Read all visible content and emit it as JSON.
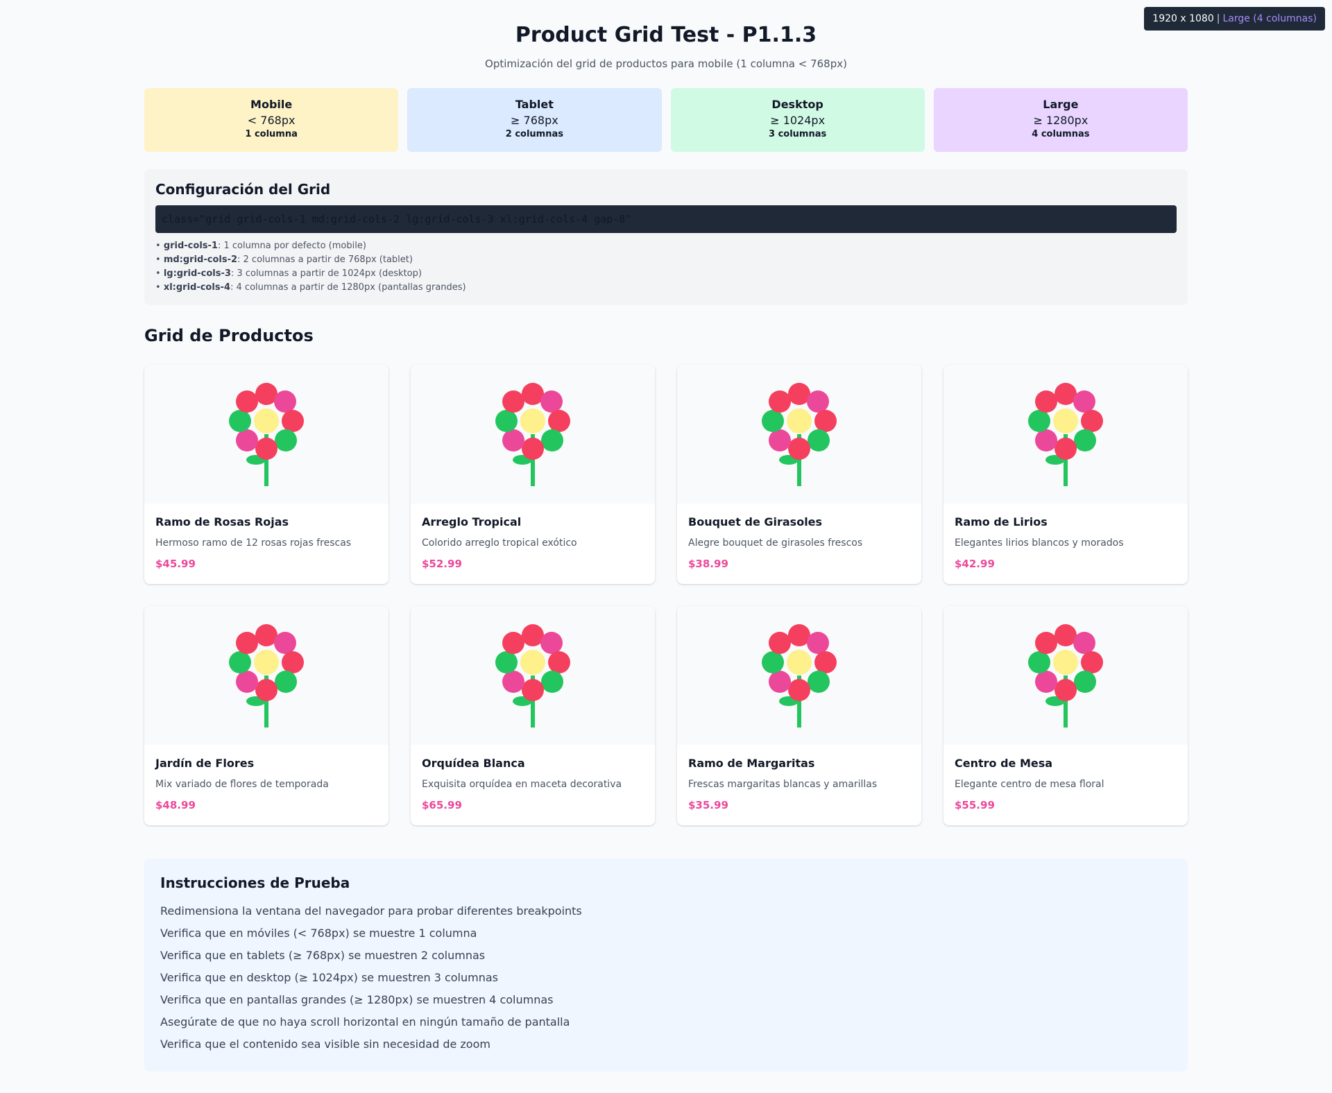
{
  "viewport_badge": {
    "size": "1920 x 1080",
    "label": "Large (4 columnas)"
  },
  "header": {
    "title": "Product Grid Test - P1.1.3",
    "subtitle": "Optimización del grid de productos para mobile (1 columna < 768px)"
  },
  "breakpoints": [
    {
      "title": "Mobile",
      "width": "< 768px",
      "columns": "1 columna",
      "color": "#fef3c7"
    },
    {
      "title": "Tablet",
      "width": "≥ 768px",
      "columns": "2 columnas",
      "color": "#dbeafe"
    },
    {
      "title": "Desktop",
      "width": "≥ 1024px",
      "columns": "3 columnas",
      "color": "#d1fae5"
    },
    {
      "title": "Large",
      "width": "≥ 1280px",
      "columns": "4 columnas",
      "color": "#e9d5ff"
    }
  ],
  "config": {
    "title": "Configuración del Grid",
    "code": "class=\"grid grid-cols-1 md:grid-cols-2 lg:grid-cols-3 xl:grid-cols-4 gap-8\"",
    "rules": [
      {
        "key": "grid-cols-1",
        "text": ": 1 columna por defecto (mobile)"
      },
      {
        "key": "md:grid-cols-2",
        "text": ": 2 columnas a partir de 768px (tablet)"
      },
      {
        "key": "lg:grid-cols-3",
        "text": ": 3 columnas a partir de 1024px (desktop)"
      },
      {
        "key": "xl:grid-cols-4",
        "text": ": 4 columnas a partir de 1280px (pantallas grandes)"
      }
    ]
  },
  "grid": {
    "title": "Grid de Productos",
    "products": [
      {
        "name": "Ramo de Rosas Rojas",
        "description": "Hermoso ramo de 12 rosas rojas frescas",
        "price": "$45.99"
      },
      {
        "name": "Arreglo Tropical",
        "description": "Colorido arreglo tropical exótico",
        "price": "$52.99"
      },
      {
        "name": "Bouquet de Girasoles",
        "description": "Alegre bouquet de girasoles frescos",
        "price": "$38.99"
      },
      {
        "name": "Ramo de Lirios",
        "description": "Elegantes lirios blancos y morados",
        "price": "$42.99"
      },
      {
        "name": "Jardín de Flores",
        "description": "Mix variado de flores de temporada",
        "price": "$48.99"
      },
      {
        "name": "Orquídea Blanca",
        "description": "Exquisita orquídea en maceta decorativa",
        "price": "$65.99"
      },
      {
        "name": "Ramo de Margaritas",
        "description": "Frescas margaritas blancas y amarillas",
        "price": "$35.99"
      },
      {
        "name": "Centro de Mesa",
        "description": "Elegante centro de mesa floral",
        "price": "$55.99"
      }
    ]
  },
  "instructions": {
    "title": "Instrucciones de Prueba",
    "items": [
      "Redimensiona la ventana del navegador para probar diferentes breakpoints",
      "Verifica que en móviles (< 768px) se muestre 1 columna",
      "Verifica que en tablets (≥ 768px) se muestren 2 columnas",
      "Verifica que en desktop (≥ 1024px) se muestren 3 columnas",
      "Verifica que en pantallas grandes (≥ 1280px) se muestren 4 columnas",
      "Asegúrate de que no haya scroll horizontal en ningún tamaño de pantalla",
      "Verifica que el contenido sea visible sin necesidad de zoom"
    ]
  },
  "colors": {
    "price": "#ec4899",
    "accent": "#a78bfa",
    "code_bg": "#1f2937"
  }
}
